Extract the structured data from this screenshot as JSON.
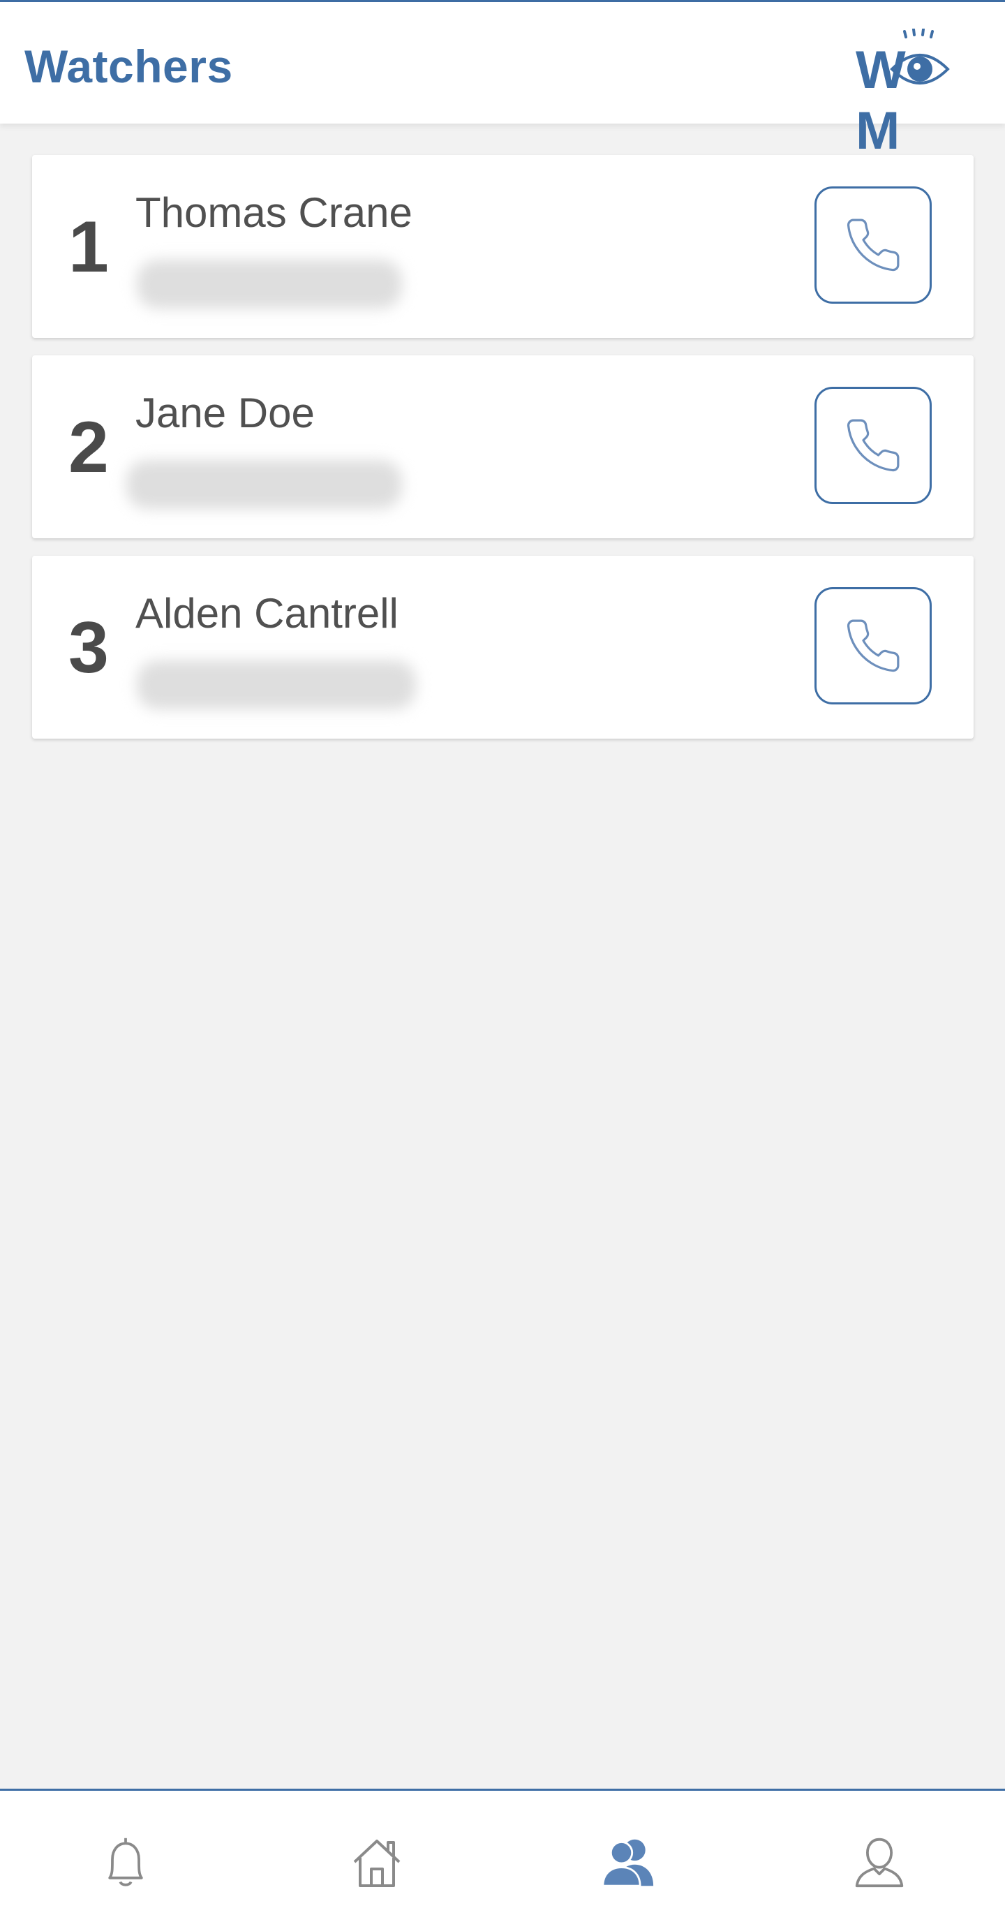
{
  "header": {
    "title": "Watchers",
    "logo_letters": [
      "W",
      "M"
    ]
  },
  "watchers": [
    {
      "rank": "1",
      "name": "Thomas Crane"
    },
    {
      "rank": "2",
      "name": "Jane Doe"
    },
    {
      "rank": "3",
      "name": "Alden Cantrell"
    }
  ],
  "bottom_nav": [
    {
      "icon": "bell-icon",
      "active": false
    },
    {
      "icon": "home-icon",
      "active": false
    },
    {
      "icon": "watchers-icon",
      "active": true
    },
    {
      "icon": "profile-icon",
      "active": false
    }
  ],
  "colors": {
    "accent": "#3e6ea5",
    "background": "#f2f2f2",
    "card": "#ffffff",
    "text": "#505050",
    "icon_inactive": "#8a8a8a"
  }
}
